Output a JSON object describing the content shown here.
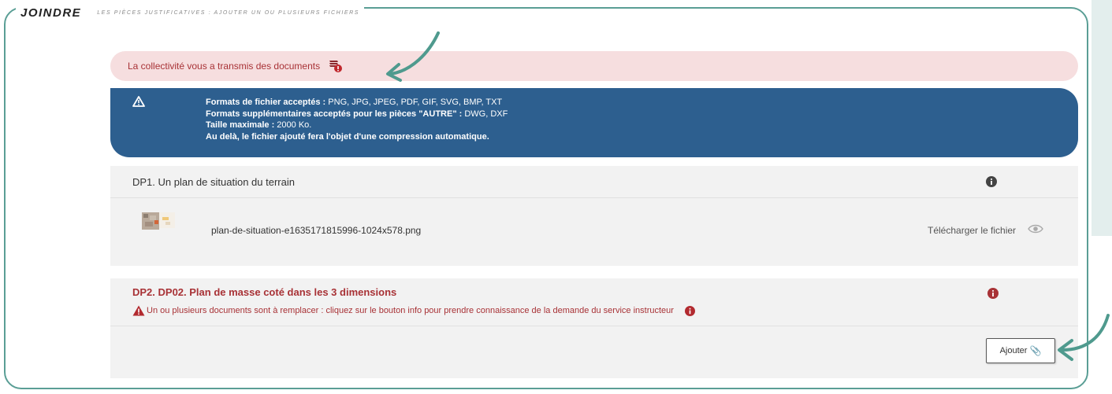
{
  "header": {
    "title": "JOINDRE",
    "subtitle": "LES PIÈCES JUSTIFICATIVES : AJOUTER UN OU PLUSIEURS FICHIERS"
  },
  "alert": {
    "text": "La collectivité vous a transmis des documents",
    "icon": "documents-badge-icon",
    "color": "#a83236"
  },
  "formats_info": {
    "line1_label": "Formats de fichier acceptés :",
    "line1_value": " PNG, JPG, JPEG, PDF, GIF, SVG, BMP, TXT",
    "line2_label": "Formats supplémentaires acceptés pour les pièces \"AUTRE\" :",
    "line2_value": " DWG, DXF",
    "line3_label": "Taille maximale :",
    "line3_value": " 2000 Ko.",
    "line4": "Au delà, le fichier ajouté fera l'objet d'une compression automatique.",
    "background": "#2d5f8f"
  },
  "pieces": [
    {
      "title": "DP1. Un plan de situation du terrain",
      "file_name": "plan-de-situation-e1635171815996-1024x578.png",
      "download_label": "Télécharger le fichier"
    },
    {
      "title": "DP2. DP02. Plan de masse coté dans les 3 dimensions",
      "warning": "Un ou plusieurs documents sont à remplacer : cliquez sur le bouton info pour prendre connaissance de la demande du service instructeur",
      "add_label": "Ajouter"
    }
  ],
  "colors": {
    "accent_teal": "#5a9e95",
    "error_red": "#a83236"
  }
}
